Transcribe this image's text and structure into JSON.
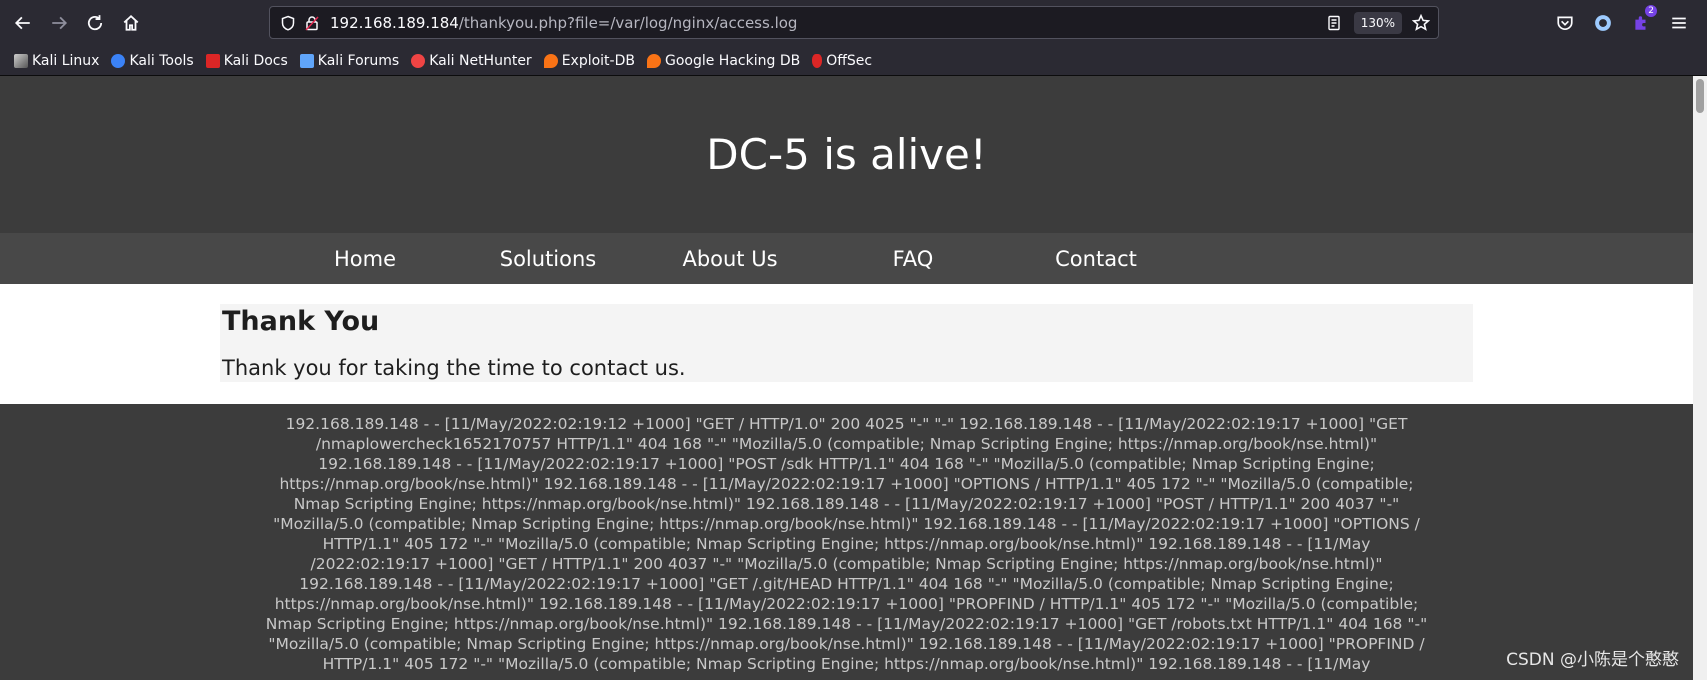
{
  "browser": {
    "url_host": "192.168.189.184",
    "url_path": "/thankyou.php?file=/var/log/nginx/access.log",
    "zoom": "130%",
    "extensions_badge": "2"
  },
  "bookmarks": [
    {
      "label": "Kali Linux",
      "icon": "kali-dragon-icon",
      "color": "#cfcfcf"
    },
    {
      "label": "Kali Tools",
      "icon": "kali-tools-icon",
      "color": "#3b82f6"
    },
    {
      "label": "Kali Docs",
      "icon": "kali-docs-icon",
      "color": "#dc2626"
    },
    {
      "label": "Kali Forums",
      "icon": "kali-forums-icon",
      "color": "#60a5fa"
    },
    {
      "label": "Kali NetHunter",
      "icon": "nethunter-icon",
      "color": "#ef4444"
    },
    {
      "label": "Exploit-DB",
      "icon": "exploit-db-icon",
      "color": "#f97316"
    },
    {
      "label": "Google Hacking DB",
      "icon": "ghdb-icon",
      "color": "#f97316"
    },
    {
      "label": "OffSec",
      "icon": "offsec-icon",
      "color": "#dc2626"
    }
  ],
  "site": {
    "title": "DC-5 is alive!",
    "nav": [
      "Home",
      "Solutions",
      "About Us",
      "FAQ",
      "Contact"
    ],
    "heading": "Thank You",
    "message": "Thank you for taking the time to contact us.",
    "log_lines": [
      "192.168.189.148 - - [11/May/2022:02:19:12 +1000] \"GET / HTTP/1.0\" 200 4025 \"-\" \"-\" 192.168.189.148 - - [11/May/2022:02:19:17 +1000] \"GET",
      "/nmaplowercheck1652170757 HTTP/1.1\" 404 168 \"-\" \"Mozilla/5.0 (compatible; Nmap Scripting Engine; https://nmap.org/book/nse.html)\"",
      "192.168.189.148 - - [11/May/2022:02:19:17 +1000] \"POST /sdk HTTP/1.1\" 404 168 \"-\" \"Mozilla/5.0 (compatible; Nmap Scripting Engine;",
      "https://nmap.org/book/nse.html)\" 192.168.189.148 - - [11/May/2022:02:19:17 +1000] \"OPTIONS / HTTP/1.1\" 405 172 \"-\" \"Mozilla/5.0 (compatible;",
      "Nmap Scripting Engine; https://nmap.org/book/nse.html)\" 192.168.189.148 - - [11/May/2022:02:19:17 +1000] \"POST / HTTP/1.1\" 200 4037 \"-\"",
      "\"Mozilla/5.0 (compatible; Nmap Scripting Engine; https://nmap.org/book/nse.html)\" 192.168.189.148 - - [11/May/2022:02:19:17 +1000] \"OPTIONS /",
      "HTTP/1.1\" 405 172 \"-\" \"Mozilla/5.0 (compatible; Nmap Scripting Engine; https://nmap.org/book/nse.html)\" 192.168.189.148 - - [11/May",
      "/2022:02:19:17 +1000] \"GET / HTTP/1.1\" 200 4037 \"-\" \"Mozilla/5.0 (compatible; Nmap Scripting Engine; https://nmap.org/book/nse.html)\"",
      "192.168.189.148 - - [11/May/2022:02:19:17 +1000] \"GET /.git/HEAD HTTP/1.1\" 404 168 \"-\" \"Mozilla/5.0 (compatible; Nmap Scripting Engine;",
      "https://nmap.org/book/nse.html)\" 192.168.189.148 - - [11/May/2022:02:19:17 +1000] \"PROPFIND / HTTP/1.1\" 405 172 \"-\" \"Mozilla/5.0 (compatible;",
      "Nmap Scripting Engine; https://nmap.org/book/nse.html)\" 192.168.189.148 - - [11/May/2022:02:19:17 +1000] \"GET /robots.txt HTTP/1.1\" 404 168 \"-\"",
      "\"Mozilla/5.0 (compatible; Nmap Scripting Engine; https://nmap.org/book/nse.html)\" 192.168.189.148 - - [11/May/2022:02:19:17 +1000] \"PROPFIND /",
      "HTTP/1.1\" 405 172 \"-\" \"Mozilla/5.0 (compatible; Nmap Scripting Engine; https://nmap.org/book/nse.html)\" 192.168.189.148 - - [11/May"
    ]
  },
  "watermark": "CSDN @小陈是个憨憨"
}
